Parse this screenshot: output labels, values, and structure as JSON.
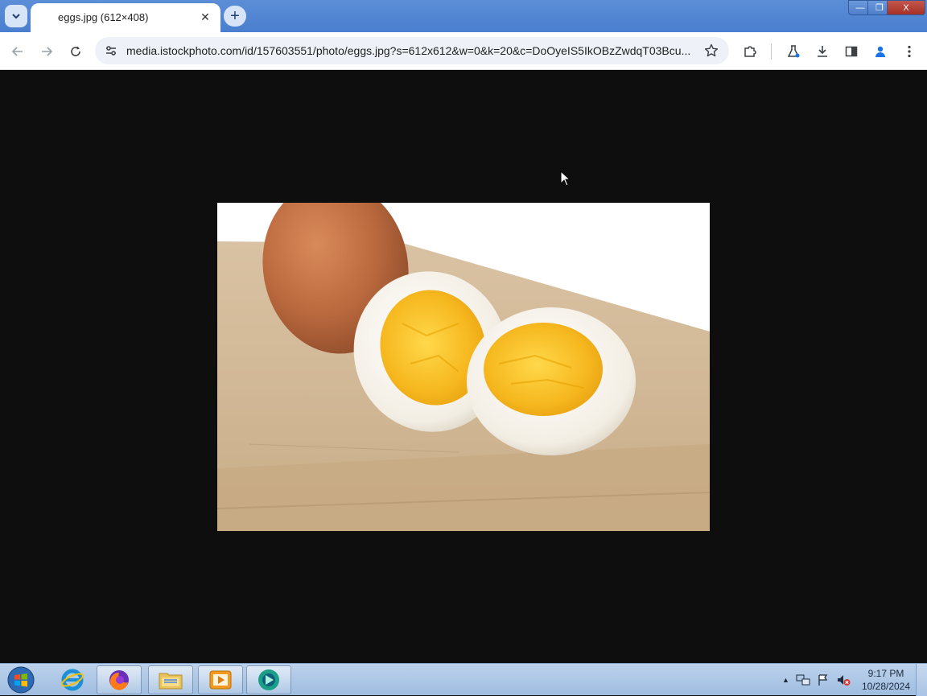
{
  "browser": {
    "tab": {
      "title": "eggs.jpg (612×408)"
    },
    "window_controls": {
      "minimize": "—",
      "maximize": "❐",
      "close": "X"
    },
    "address_bar": {
      "url": "media.istockphoto.com/id/157603551/photo/eggs.jpg?s=612x612&w=0&k=20&c=DoOyeIS5IkOBzZwdqT03Bcu..."
    }
  },
  "content": {
    "image_name": "eggs.jpg",
    "image_size": "612×408",
    "background": "#0e0e0e"
  },
  "taskbar": {
    "apps": [
      "internet-explorer",
      "firefox",
      "file-explorer",
      "media-player",
      "chrome-like-app"
    ],
    "clock": {
      "time": "9:17 PM",
      "date": "10/28/2024"
    }
  },
  "colors": {
    "titlebar": "#4a7fcf",
    "toolbar": "#ffffff",
    "taskbar": "#a9c4e6"
  }
}
